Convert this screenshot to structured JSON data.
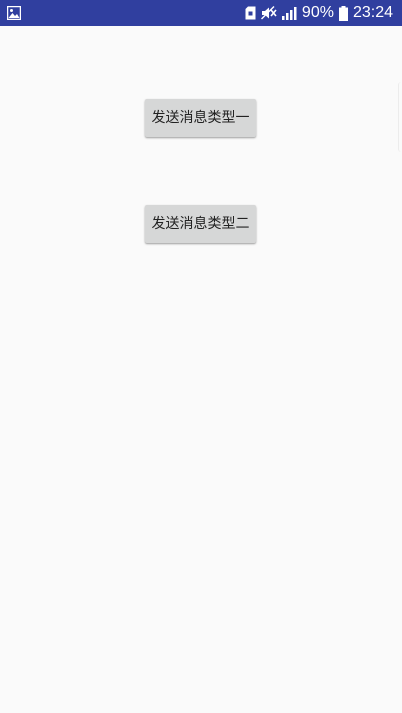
{
  "status_bar": {
    "color": "#303f9f",
    "left_icon": "image-notification-icon",
    "icons": [
      "sim-card-icon",
      "mute-icon",
      "signal-icon",
      "battery-icon"
    ],
    "battery": "90%",
    "time": "23:24"
  },
  "main": {
    "buttons": [
      {
        "label": "发送消息类型一"
      },
      {
        "label": "发送消息类型二"
      }
    ]
  },
  "colors": {
    "background": "#fafafa",
    "button_bg": "#d6d7d7",
    "button_text": "#222222"
  }
}
